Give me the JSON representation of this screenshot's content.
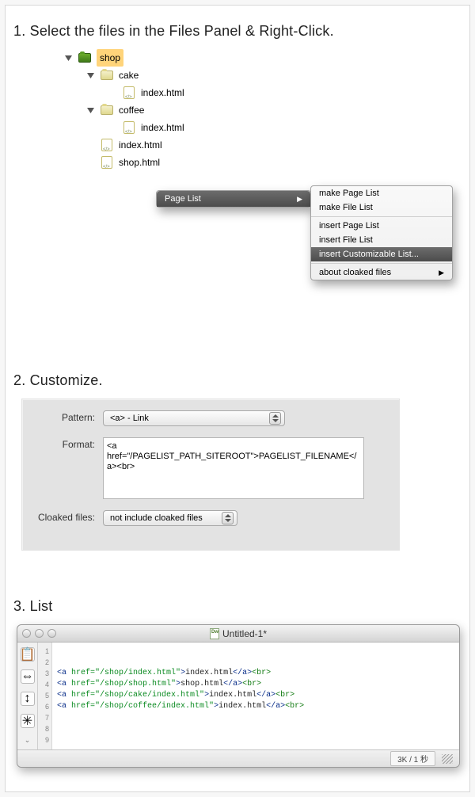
{
  "step1": {
    "heading": "1. Select the files  in the Files Panel & Right-Click.",
    "tree": {
      "root": "shop",
      "cake": "cake",
      "cake_file": "index.html",
      "coffee": "coffee",
      "coffee_file": "index.html",
      "f1": "index.html",
      "f2": "shop.html"
    },
    "menu": {
      "header": "Page List",
      "items": [
        "make Page List",
        "make File List",
        "insert Page List",
        "insert File List",
        "insert Customizable List...",
        "about cloaked files"
      ]
    }
  },
  "step2": {
    "heading": "2. Customize.",
    "pattern_label": "Pattern:",
    "pattern_value": "<a> - Link",
    "format_label": "Format:",
    "format_value": "<a href=\"/PAGELIST_PATH_SITEROOT\">PAGELIST_FILENAME</a><br>",
    "cloaked_label": "Cloaked files:",
    "cloaked_value": "not include cloaked files"
  },
  "step3": {
    "heading": "3. List",
    "doc_title": "Untitled-1*",
    "lines": [
      "1",
      "2",
      "3",
      "4",
      "5",
      "6",
      "7",
      "8",
      "9"
    ],
    "code": [
      {
        "href": "/shop/index.html",
        "text": "index.html"
      },
      {
        "href": "/shop/shop.html",
        "text": "shop.html"
      },
      {
        "href": "/shop/cake/index.html",
        "text": "index.html"
      },
      {
        "href": "/shop/coffee/index.html",
        "text": "index.html"
      }
    ],
    "status": "3K / 1 秒"
  }
}
